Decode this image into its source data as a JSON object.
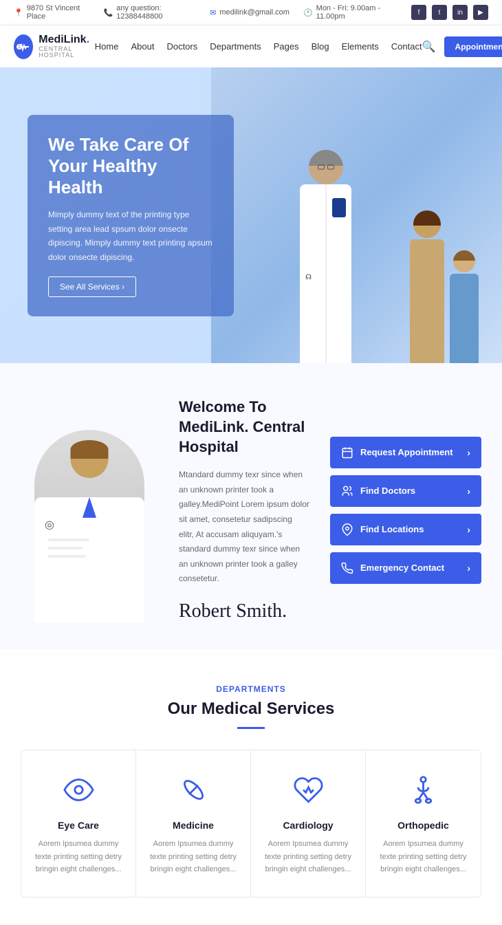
{
  "topbar": {
    "address": "9870 St Vincent Place",
    "phone": "any question: 12388448800",
    "email": "medilink@gmail.com",
    "hours": "Mon - Fri: 9.00am - 11.00pm"
  },
  "logo": {
    "brand": "MediLink.",
    "sub": "CENTRAL HOSPITAL",
    "icon_symbol": "+"
  },
  "nav": {
    "links": [
      "Home",
      "About",
      "Doctors",
      "Departments",
      "Pages",
      "Blog",
      "Elements",
      "Contact"
    ],
    "appointment_btn": "Appointment"
  },
  "hero": {
    "title": "We Take Care Of Your Healthy Health",
    "description": "Mimply dummy text of the printing type setting area lead spsum dolor onsecte dipiscing. Mimply dummy text printing apsum dolor onsecte dipiscing.",
    "cta": "See All Services  ›"
  },
  "welcome": {
    "title": "Welcome To MediLink. Central Hospital",
    "description": "Mtandard dummy texr since when an unknown printer took a galley.MediPoint Lorem ipsum dolor sit amet, consetetur sadipscing elitr, At accusam aliquyam.'s standard dummy texr since when an unknown printer took a galley consetetur.",
    "signature": "Robert Smith."
  },
  "action_buttons": [
    {
      "id": "request-appointment",
      "label": "Request Appointment",
      "icon": "calendar"
    },
    {
      "id": "find-doctors",
      "label": "Find Doctors",
      "icon": "people"
    },
    {
      "id": "find-locations",
      "label": "Find Locations",
      "icon": "pin"
    },
    {
      "id": "emergency-contact",
      "label": "Emergency Contact",
      "icon": "phone"
    }
  ],
  "departments": {
    "section_label": "Departments",
    "title": "Our Medical Services",
    "services": [
      {
        "id": "eye-care",
        "label": "Eye Care",
        "description": "Aorem Ipsumea dummy texte printing setting detry bringin eight challenges...",
        "icon": "eye"
      },
      {
        "id": "medicine",
        "label": "Medicine",
        "description": "Aorem Ipsumea dummy texte printing setting detry bringin eight challenges...",
        "icon": "pill"
      },
      {
        "id": "cardiology",
        "label": "Cardiology",
        "description": "Aorem Ipsumea dummy texte printing setting detry bringin eight challenges...",
        "icon": "heart"
      },
      {
        "id": "orthopedic",
        "label": "Orthopedic",
        "description": "Aorem Ipsumea dummy texte printing setting detry bringin eight challenges...",
        "icon": "bone"
      }
    ]
  },
  "social": [
    "fb",
    "tw",
    "li",
    "yt"
  ],
  "colors": {
    "primary": "#3b5de7",
    "dark": "#1a1a2e",
    "text_light": "#666",
    "bg_light": "#f8faff"
  }
}
